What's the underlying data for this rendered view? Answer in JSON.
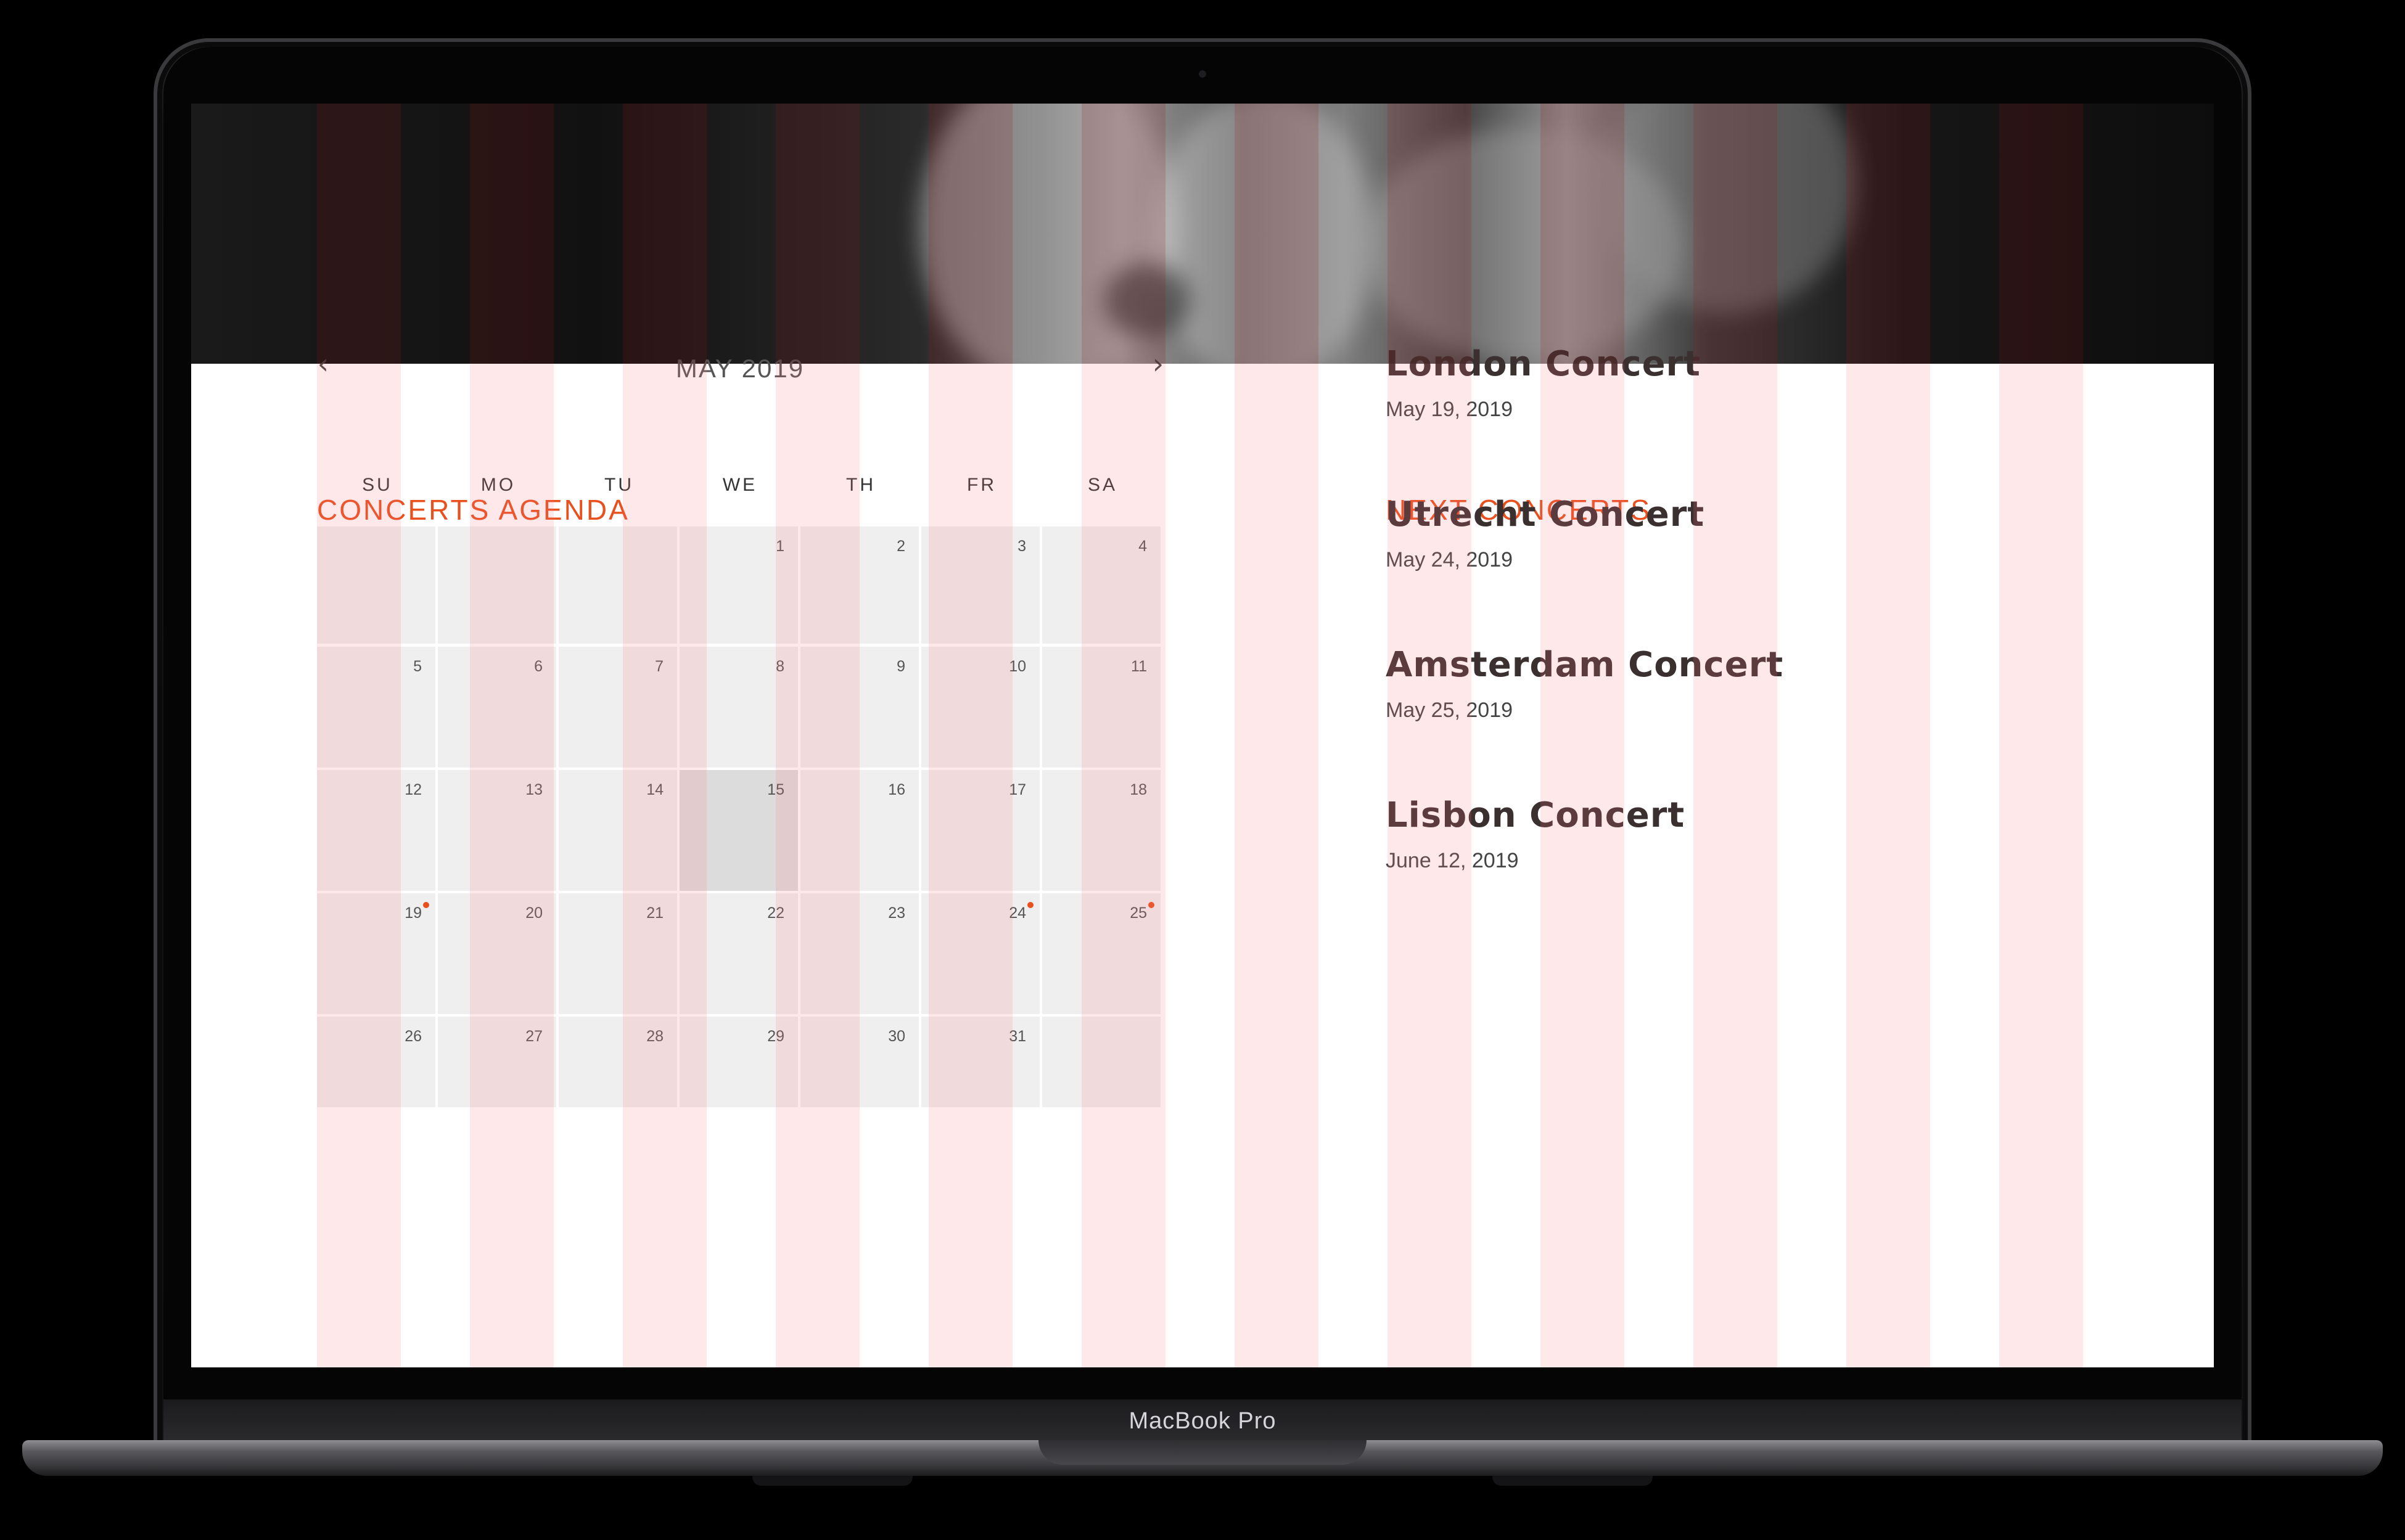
{
  "device": {
    "label": "MacBook Pro"
  },
  "agenda": {
    "title": "CONCERTS AGENDA",
    "month": "MAY 2019",
    "prev_icon": "chevron-left-icon",
    "next_icon": "chevron-right-icon",
    "weekdays": [
      "SU",
      "MO",
      "TU",
      "WE",
      "TH",
      "FR",
      "SA"
    ],
    "weeks": [
      [
        "",
        "",
        "",
        "1",
        "2",
        "3",
        "4"
      ],
      [
        "5",
        "6",
        "7",
        "8",
        "9",
        "10",
        "11"
      ],
      [
        "12",
        "13",
        "14",
        "15",
        "16",
        "17",
        "18"
      ],
      [
        "19",
        "20",
        "21",
        "22",
        "23",
        "24",
        "25"
      ],
      [
        "26",
        "27",
        "28",
        "29",
        "30",
        "31",
        ""
      ]
    ],
    "highlighted_day": "15",
    "event_days": [
      "19",
      "24",
      "25"
    ]
  },
  "next_concerts": {
    "title": "NEXT CONCERTS",
    "items": [
      {
        "name": "London Concert",
        "date": "May 19, 2019"
      },
      {
        "name": "Utrecht Concert",
        "date": "May 24, 2019"
      },
      {
        "name": "Amsterdam Concert",
        "date": "May 25, 2019"
      },
      {
        "name": "Lisbon Concert",
        "date": "June 12, 2019"
      }
    ]
  },
  "colors": {
    "accent": "#e8501e",
    "grid_overlay": "#ffd9dc",
    "cell_background": "#efefef",
    "heading_text": "#3a3030"
  }
}
